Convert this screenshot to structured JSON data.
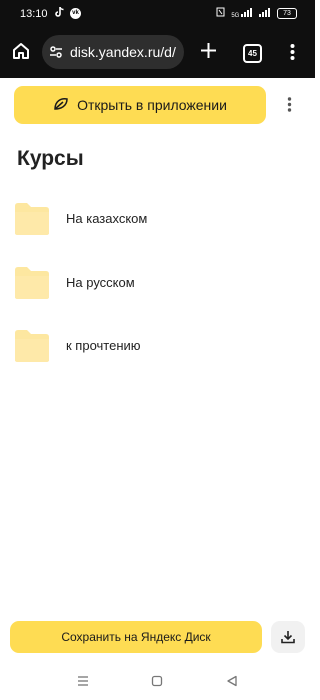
{
  "status_bar": {
    "time": "13:10",
    "battery": "73",
    "network": "5G"
  },
  "browser": {
    "url": "disk.yandex.ru/d/",
    "tab_count": "45"
  },
  "open_app_button": "Открыть в приложении",
  "page_title": "Курсы",
  "folders": [
    {
      "name": "На казахском"
    },
    {
      "name": "На русском"
    },
    {
      "name": "к прочтению"
    }
  ],
  "save_button": "Сохранить на Яндекс Диск",
  "icons": {
    "home": "home-icon",
    "tune": "tune-icon",
    "plus": "plus-icon",
    "tabs": "tabs-icon",
    "menu": "more-vert-icon",
    "leaf": "leaf-icon",
    "folder": "folder-icon",
    "download": "download-icon"
  },
  "colors": {
    "accent_yellow": "#fedc53",
    "folder_yellow": "#fde7a0",
    "toolbar_bg": "#0f0f0f"
  }
}
